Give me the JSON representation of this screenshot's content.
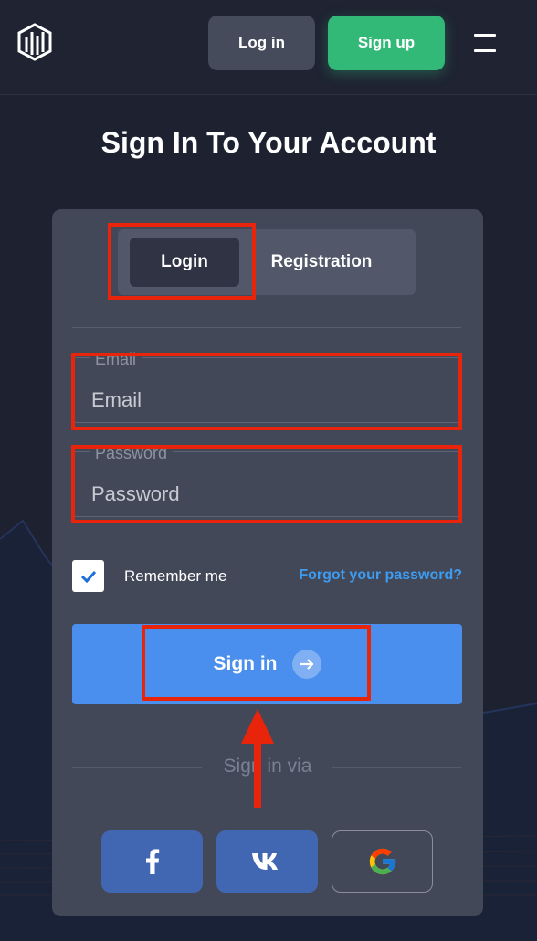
{
  "header": {
    "login_label": "Log in",
    "signup_label": "Sign up"
  },
  "page_title": "Sign In To Your Account",
  "tabs": {
    "login": "Login",
    "registration": "Registration"
  },
  "email": {
    "label": "Email",
    "placeholder": "Email"
  },
  "password": {
    "label": "Password",
    "placeholder": "Password"
  },
  "remember_me": {
    "label": "Remember me",
    "checked": true
  },
  "forgot_password": "Forgot your password?",
  "signin_label": "Sign in",
  "sign_in_via": "Sign in via",
  "icons": {
    "logo": "logo-icon",
    "menu": "hamburger-menu-icon",
    "check": "check-icon",
    "arrow": "arrow-right-icon",
    "facebook": "facebook-icon",
    "vk": "vk-icon",
    "google": "google-icon"
  },
  "colors": {
    "background": "#1d2130",
    "card": "#434858",
    "signup": "#32b877",
    "primary": "#4a8fee",
    "link": "#3d9cf0",
    "social": "#4267b2",
    "annotation": "#e8240b"
  }
}
